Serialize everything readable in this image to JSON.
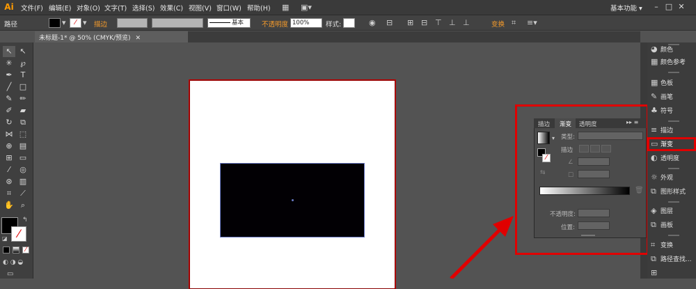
{
  "app": {
    "logo": "Ai",
    "workspace": "基本功能",
    "workspace_arrow": "▾"
  },
  "menu": [
    "文件(F)",
    "编辑(E)",
    "对象(O)",
    "文字(T)",
    "选择(S)",
    "效果(C)",
    "视图(V)",
    "窗口(W)",
    "帮助(H)"
  ],
  "control": {
    "selection": "路径",
    "stroke_label": "描边",
    "stroke_style": "基本",
    "opacity_label": "不透明度",
    "opacity_value": "100%",
    "style_label": "样式:",
    "transform_label": "变换"
  },
  "document_tab": "未标题-1* @ 50% (CMYK/预览)",
  "dock": [
    {
      "label": "颜色",
      "icon": "color-icon"
    },
    {
      "label": "颜色参考",
      "icon": "color-guide-icon"
    },
    {
      "label": "色板",
      "icon": "swatches-icon"
    },
    {
      "label": "画笔",
      "icon": "brushes-icon"
    },
    {
      "label": "符号",
      "icon": "symbols-icon"
    },
    {
      "label": "描边",
      "icon": "stroke-icon"
    },
    {
      "label": "渐变",
      "icon": "gradient-icon"
    },
    {
      "label": "透明度",
      "icon": "transparency-icon"
    },
    {
      "label": "外观",
      "icon": "appearance-icon"
    },
    {
      "label": "图形样式",
      "icon": "graphic-styles-icon"
    },
    {
      "label": "图层",
      "icon": "layers-icon"
    },
    {
      "label": "画板",
      "icon": "artboards-icon"
    },
    {
      "label": "变换",
      "icon": "transform-icon"
    },
    {
      "label": "路径查找...",
      "icon": "pathfinder-icon"
    }
  ],
  "gradient_panel": {
    "tabs": [
      "描边",
      "渐变",
      "透明度"
    ],
    "type_label": "类型:",
    "stroke_label": "描边",
    "angle_label": "∠",
    "ratio_label": "□",
    "opacity_label": "不透明度:",
    "location_label": "位置:"
  },
  "colors": {
    "accent_red": "#e00000",
    "menu_bg": "#3a3a3a",
    "canvas_bg": "#535353",
    "orange": "#f39a2b"
  }
}
